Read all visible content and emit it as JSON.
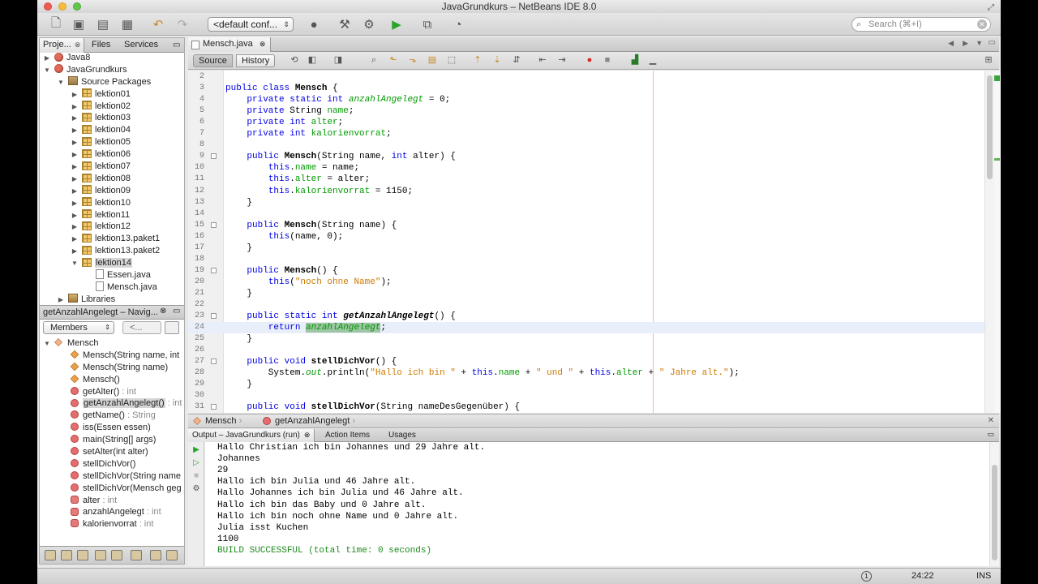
{
  "window": {
    "title": "JavaGrundkurs – NetBeans IDE 8.0"
  },
  "toolbar": {
    "config_value": "<default conf...",
    "search_placeholder": "Search (⌘+I)"
  },
  "projects_panel": {
    "tabs": [
      "Proje...",
      "Files",
      "Services"
    ],
    "tree": [
      {
        "level": 0,
        "toggle": "closed",
        "icon": "project",
        "label": "Java8"
      },
      {
        "level": 0,
        "toggle": "open",
        "icon": "project",
        "label": "JavaGrundkurs"
      },
      {
        "level": 1,
        "toggle": "open",
        "icon": "source-packages",
        "label": "Source Packages"
      },
      {
        "level": 2,
        "toggle": "closed",
        "icon": "package",
        "label": "lektion01"
      },
      {
        "level": 2,
        "toggle": "closed",
        "icon": "package",
        "label": "lektion02"
      },
      {
        "level": 2,
        "toggle": "closed",
        "icon": "package",
        "label": "lektion03"
      },
      {
        "level": 2,
        "toggle": "closed",
        "icon": "package",
        "label": "lektion04"
      },
      {
        "level": 2,
        "toggle": "closed",
        "icon": "package",
        "label": "lektion05"
      },
      {
        "level": 2,
        "toggle": "closed",
        "icon": "package",
        "label": "lektion06"
      },
      {
        "level": 2,
        "toggle": "closed",
        "icon": "package",
        "label": "lektion07"
      },
      {
        "level": 2,
        "toggle": "closed",
        "icon": "package",
        "label": "lektion08"
      },
      {
        "level": 2,
        "toggle": "closed",
        "icon": "package",
        "label": "lektion09"
      },
      {
        "level": 2,
        "toggle": "closed",
        "icon": "package",
        "label": "lektion10"
      },
      {
        "level": 2,
        "toggle": "closed",
        "icon": "package",
        "label": "lektion11"
      },
      {
        "level": 2,
        "toggle": "closed",
        "icon": "package",
        "label": "lektion12"
      },
      {
        "level": 2,
        "toggle": "closed",
        "icon": "package",
        "label": "lektion13.paket1"
      },
      {
        "level": 2,
        "toggle": "closed",
        "icon": "package",
        "label": "lektion13.paket2"
      },
      {
        "level": 2,
        "toggle": "open",
        "icon": "package",
        "label": "lektion14",
        "selected": true
      },
      {
        "level": 3,
        "toggle": "none",
        "icon": "java-file",
        "label": "Essen.java"
      },
      {
        "level": 3,
        "toggle": "none",
        "icon": "java-file",
        "label": "Mensch.java"
      },
      {
        "level": 1,
        "toggle": "closed",
        "icon": "libraries",
        "label": "Libraries"
      }
    ]
  },
  "navigator": {
    "title": "getAnzahlAngelegt – Navig...",
    "filter_value": "Members",
    "scope_value": "<...",
    "root": "Mensch",
    "members": [
      {
        "kind": "ctor",
        "name": "Mensch(String name, int",
        "ret": ""
      },
      {
        "kind": "ctor",
        "name": "Mensch(String name)",
        "ret": ""
      },
      {
        "kind": "ctor",
        "name": "Mensch()",
        "ret": ""
      },
      {
        "kind": "method",
        "name": "getAlter()",
        "ret": " : int"
      },
      {
        "kind": "method",
        "name": "getAnzahlAngelegt()",
        "ret": " : int",
        "selected": true
      },
      {
        "kind": "method",
        "name": "getName()",
        "ret": " : String"
      },
      {
        "kind": "method",
        "name": "iss(Essen essen)",
        "ret": ""
      },
      {
        "kind": "method",
        "name": "main(String[] args)",
        "ret": ""
      },
      {
        "kind": "method",
        "name": "setAlter(int alter)",
        "ret": ""
      },
      {
        "kind": "method",
        "name": "stellDichVor()",
        "ret": ""
      },
      {
        "kind": "method",
        "name": "stellDichVor(String name",
        "ret": ""
      },
      {
        "kind": "method",
        "name": "stellDichVor(Mensch geg",
        "ret": ""
      },
      {
        "kind": "field",
        "name": "alter",
        "ret": " : int"
      },
      {
        "kind": "field",
        "name": "anzahlAngelegt",
        "ret": " : int"
      },
      {
        "kind": "field",
        "name": "kalorienvorrat",
        "ret": " : int"
      }
    ]
  },
  "editor": {
    "tab_label": "Mensch.java",
    "source_label": "Source",
    "history_label": "History",
    "current_line": 24,
    "lines": [
      {
        "n": "2",
        "html": ""
      },
      {
        "n": "3",
        "html": "<span class='kw'>public class</span> <span class='bold'>Mensch</span> {"
      },
      {
        "n": "4",
        "html": "    <span class='kw'>private static int</span> <span class='sfld'>anzahlAngelegt</span> = 0;"
      },
      {
        "n": "5",
        "html": "    <span class='kw'>private</span> String <span class='fld'>name</span>;"
      },
      {
        "n": "6",
        "html": "    <span class='kw'>private int</span> <span class='fld'>alter</span>;"
      },
      {
        "n": "7",
        "html": "    <span class='kw'>private int</span> <span class='fld'>kalorienvorrat</span>;"
      },
      {
        "n": "8",
        "html": ""
      },
      {
        "n": "9",
        "html": "    <span class='kw'>public</span> <span class='bold'>Mensch</span>(String name, <span class='kw'>int</span> alter) {",
        "fold": true
      },
      {
        "n": "10",
        "html": "        <span class='kw'>this</span>.<span class='fld'>name</span> = name;"
      },
      {
        "n": "11",
        "html": "        <span class='kw'>this</span>.<span class='fld'>alter</span> = alter;"
      },
      {
        "n": "12",
        "html": "        <span class='kw'>this</span>.<span class='fld'>kalorienvorrat</span> = 1150;"
      },
      {
        "n": "13",
        "html": "    }"
      },
      {
        "n": "14",
        "html": ""
      },
      {
        "n": "15",
        "html": "    <span class='kw'>public</span> <span class='bold'>Mensch</span>(String name) {",
        "fold": true
      },
      {
        "n": "16",
        "html": "        <span class='kw'>this</span>(name, 0);"
      },
      {
        "n": "17",
        "html": "    }"
      },
      {
        "n": "18",
        "html": ""
      },
      {
        "n": "19",
        "html": "    <span class='kw'>public</span> <span class='bold'>Mensch</span>() {",
        "fold": true
      },
      {
        "n": "20",
        "html": "        <span class='kw'>this</span>(<span class='str'>\"noch ohne Name\"</span>);"
      },
      {
        "n": "21",
        "html": "    }"
      },
      {
        "n": "22",
        "html": ""
      },
      {
        "n": "23",
        "html": "    <span class='kw'>public static int</span> <span class='bold it'>getAnzahlAngelegt</span>() {",
        "fold": true
      },
      {
        "n": "24",
        "html": "        <span class='kw'>return</span> <span class='sfld hl'>anzahlAngelegt</span>;"
      },
      {
        "n": "25",
        "html": "    }"
      },
      {
        "n": "26",
        "html": ""
      },
      {
        "n": "27",
        "html": "    <span class='kw'>public void</span> <span class='bold'>stellDichVor</span>() {",
        "fold": true
      },
      {
        "n": "28",
        "html": "        System.<span class='sfld'>out</span>.println(<span class='str'>\"Hallo ich bin \"</span> + <span class='kw'>this</span>.<span class='fld'>name</span> + <span class='str'>\" und \"</span> + <span class='kw'>this</span>.<span class='fld'>alter</span> + <span class='str'>\" Jahre alt.\"</span>);"
      },
      {
        "n": "29",
        "html": "    }"
      },
      {
        "n": "30",
        "html": ""
      },
      {
        "n": "31",
        "html": "    <span class='kw'>public void</span> <span class='bold'>stellDichVor</span>(String nameDesGegenüber) {",
        "fold": true
      }
    ]
  },
  "breadcrumb": {
    "class_name": "Mensch",
    "method_name": "getAnzahlAngelegt"
  },
  "output": {
    "tabs": [
      "Output – JavaGrundkurs (run)",
      "Action Items",
      "Usages"
    ],
    "lines": [
      "Hallo Christian ich bin Johannes und 29 Jahre alt.",
      "Johannes",
      "29",
      "Hallo ich bin Julia und 46 Jahre alt.",
      "Hallo Johannes ich bin Julia und 46 Jahre alt.",
      "Hallo ich bin das Baby und 0 Jahre alt.",
      "Hallo ich bin noch ohne Name und 0 Jahre alt.",
      "Julia isst Kuchen",
      "1100"
    ],
    "success_line": "BUILD SUCCESSFUL (total time: 0 seconds)"
  },
  "status": {
    "notifications": "1",
    "position": "24:22",
    "mode": "INS"
  }
}
